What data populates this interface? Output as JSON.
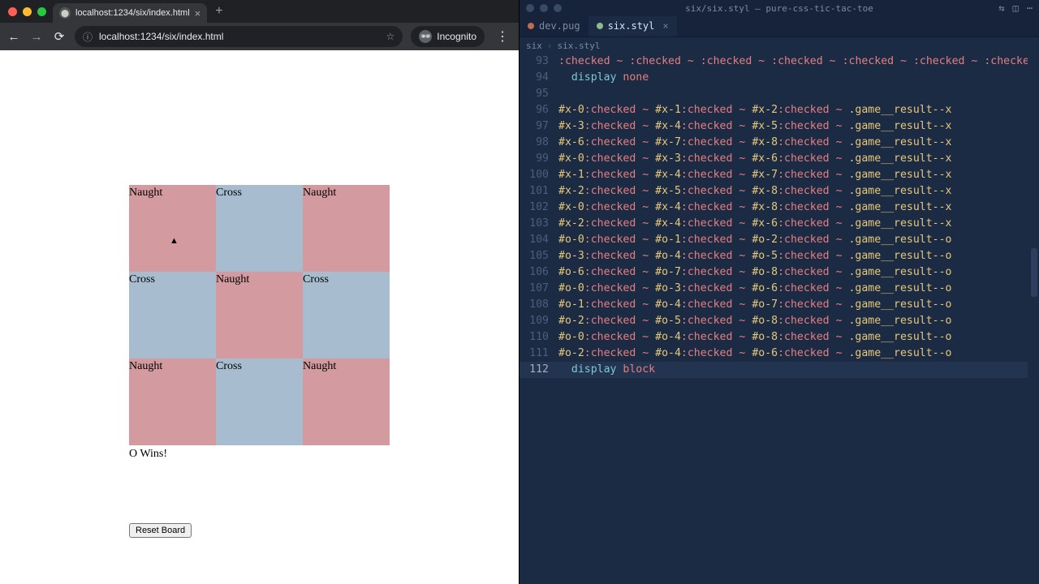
{
  "browser": {
    "tab_title": "localhost:1234/six/index.html",
    "url": "localhost:1234/six/index.html",
    "incognito_label": "Incognito"
  },
  "game": {
    "cells": [
      "Naught",
      "Cross",
      "Naught",
      "Cross",
      "Naught",
      "Cross",
      "Naught",
      "Cross",
      "Naught"
    ],
    "result": "O Wins!",
    "reset_label": "Reset Board"
  },
  "editor": {
    "window_title": "six/six.styl — pure-css-tic-tac-toe",
    "tabs": {
      "inactive": "dev.pug",
      "active": "six.styl"
    },
    "crumbs": [
      "six",
      "six.styl"
    ],
    "lines": [
      {
        "n": "93",
        "kind": "trunc",
        "text": ":checked ~ :checked ~ :checked ~ :checked ~ :checked ~ :checked ~ :checked ~ :check"
      },
      {
        "n": "94",
        "kind": "disp",
        "prop": "display",
        "val": "none"
      },
      {
        "n": "95",
        "kind": "blank"
      },
      {
        "n": "96",
        "kind": "rule",
        "a": "#x-0",
        "b": "#x-1",
        "c": "#x-2",
        "r": ".game__result--x"
      },
      {
        "n": "97",
        "kind": "rule",
        "a": "#x-3",
        "b": "#x-4",
        "c": "#x-5",
        "r": ".game__result--x"
      },
      {
        "n": "98",
        "kind": "rule",
        "a": "#x-6",
        "b": "#x-7",
        "c": "#x-8",
        "r": ".game__result--x"
      },
      {
        "n": "99",
        "kind": "rule",
        "a": "#x-0",
        "b": "#x-3",
        "c": "#x-6",
        "r": ".game__result--x"
      },
      {
        "n": "100",
        "kind": "rule",
        "a": "#x-1",
        "b": "#x-4",
        "c": "#x-7",
        "r": ".game__result--x"
      },
      {
        "n": "101",
        "kind": "rule",
        "a": "#x-2",
        "b": "#x-5",
        "c": "#x-8",
        "r": ".game__result--x"
      },
      {
        "n": "102",
        "kind": "rule",
        "a": "#x-0",
        "b": "#x-4",
        "c": "#x-8",
        "r": ".game__result--x"
      },
      {
        "n": "103",
        "kind": "rule",
        "a": "#x-2",
        "b": "#x-4",
        "c": "#x-6",
        "r": ".game__result--x"
      },
      {
        "n": "104",
        "kind": "rule",
        "a": "#o-0",
        "b": "#o-1",
        "c": "#o-2",
        "r": ".game__result--o"
      },
      {
        "n": "105",
        "kind": "rule",
        "a": "#o-3",
        "b": "#o-4",
        "c": "#o-5",
        "r": ".game__result--o"
      },
      {
        "n": "106",
        "kind": "rule",
        "a": "#o-6",
        "b": "#o-7",
        "c": "#o-8",
        "r": ".game__result--o"
      },
      {
        "n": "107",
        "kind": "rule",
        "a": "#o-0",
        "b": "#o-3",
        "c": "#o-6",
        "r": ".game__result--o"
      },
      {
        "n": "108",
        "kind": "rule",
        "a": "#o-1",
        "b": "#o-4",
        "c": "#o-7",
        "r": ".game__result--o"
      },
      {
        "n": "109",
        "kind": "rule",
        "a": "#o-2",
        "b": "#o-5",
        "c": "#o-8",
        "r": ".game__result--o"
      },
      {
        "n": "110",
        "kind": "rule",
        "a": "#o-0",
        "b": "#o-4",
        "c": "#o-8",
        "r": ".game__result--o"
      },
      {
        "n": "111",
        "kind": "rule",
        "a": "#o-2",
        "b": "#o-4",
        "c": "#o-6",
        "r": ".game__result--o"
      },
      {
        "n": "112",
        "kind": "disp",
        "prop": "display",
        "val": "block",
        "current": true
      }
    ]
  }
}
